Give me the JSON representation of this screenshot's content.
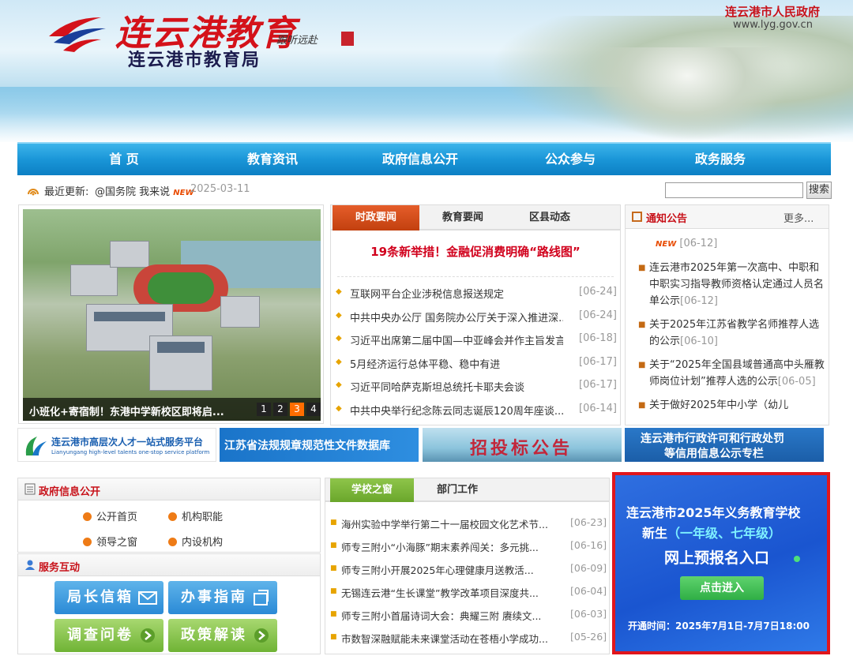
{
  "header": {
    "logo_title": "连云港教育",
    "logo_subtitle": "连云港市教育局",
    "logo_signature": "跟听远赴",
    "gov_name": "连云港市人民政府",
    "gov_url": "www.lyg.gov.cn"
  },
  "nav": {
    "items": [
      "首 页",
      "教育资讯",
      "政府信息公开",
      "公众参与",
      "政务服务"
    ]
  },
  "update_bar": {
    "label": "最近更新:",
    "text": "@国务院 我来说",
    "badge": "NEW",
    "date": "2025-03-11",
    "search_button": "搜索"
  },
  "slideshow": {
    "caption": "小班化+寄宿制！东港中学新校区即将启...",
    "pages": [
      "1",
      "2",
      "3",
      "4"
    ],
    "active_page": "3"
  },
  "news": {
    "tabs": [
      "时政要闻",
      "教育要闻",
      "区县动态"
    ],
    "headline": "19条新举措！金融促消费明确“路线图”",
    "items": [
      {
        "title": "互联网平台企业涉税信息报送规定",
        "date": "[06-24]"
      },
      {
        "title": "中共中央办公厅 国务院办公厅关于深入推进深...",
        "date": "[06-24]"
      },
      {
        "title": "习近平出席第二届中国—中亚峰会并作主旨发言",
        "date": "[06-18]"
      },
      {
        "title": "5月经济运行总体平稳、稳中有进",
        "date": "[06-17]"
      },
      {
        "title": "习近平同哈萨克斯坦总统托卡耶夫会谈",
        "date": "[06-17]"
      },
      {
        "title": "中共中央举行纪念陈云同志诞辰120周年座谈...",
        "date": "[06-14]"
      }
    ]
  },
  "notice": {
    "title": "通知公告",
    "more": "更多...",
    "top_badge": "NEW",
    "top_date": "[06-12]",
    "items": [
      {
        "title": "连云港市2025年第一次高中、中职和中职实习指导教师资格认定通过人员名单公示",
        "date": "[06-12]"
      },
      {
        "title": "关于2025年江苏省教学名师推荐人选的公示",
        "date": "[06-10]"
      },
      {
        "title": "关于“2025年全国县域普通高中头雁教师岗位计划”推荐人选的公示",
        "date": "[06-05]"
      },
      {
        "title": "关于做好2025年中小学（幼儿",
        "date": ""
      }
    ]
  },
  "banners": {
    "talent_title": "连云港市高层次人才一站式服务平台",
    "talent_sub": "Lianyungang high-level talents one-stop service platform",
    "law_db": "江苏省法规规章规范性文件数据库",
    "tender": "招投标公告",
    "credit_line1": "连云港市行政许可和行政处罚",
    "credit_line2": "等信用信息公示专栏"
  },
  "gov_info": {
    "title": "政府信息公开",
    "links": [
      "公开首页",
      "机构职能",
      "领导之窗",
      "内设机构"
    ]
  },
  "service": {
    "title": "服务互动",
    "buttons": [
      "局长信箱",
      "办事指南",
      "调查问卷",
      "政策解读"
    ]
  },
  "school": {
    "tabs": [
      "学校之窗",
      "部门工作"
    ],
    "items": [
      {
        "title": "海州实验中学举行第二十一届校园文化艺术节...",
        "date": "[06-23]"
      },
      {
        "title": "师专三附小“小海豚”期末素养闯关：多元挑...",
        "date": "[06-16]"
      },
      {
        "title": "师专三附小开展2025年心理健康月送教活...",
        "date": "[06-09]"
      },
      {
        "title": "无锡连云港“生长课堂”教学改革项目深度共...",
        "date": "[06-04]"
      },
      {
        "title": "师专三附小首届诗词大会：典耀三附 赓续文...",
        "date": "[06-03]"
      },
      {
        "title": "市数智深融赋能未来课堂活动在苍梧小学成功...",
        "date": "[05-26]"
      }
    ]
  },
  "enroll": {
    "line1": "连云港市2025年义务教育学校",
    "line2_prefix": "新生",
    "line2_highlight": "（一年级、七年级）",
    "line3": "网上预报名入口",
    "button": "点击进入",
    "time": "开通时间：2025年7月1日-7月7日18:00"
  },
  "colors": {
    "nav_blue": "#1a96d8",
    "accent_red": "#c8121a",
    "orange": "#ff6d00",
    "enroll_blue": "#1a55d0"
  }
}
